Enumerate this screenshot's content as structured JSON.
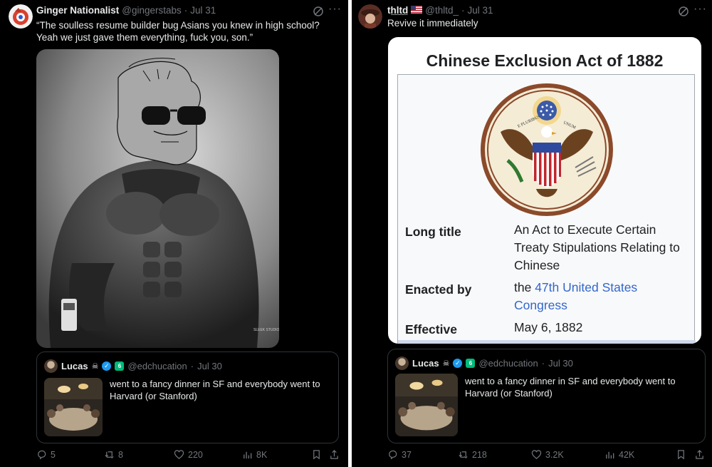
{
  "left_tweet": {
    "display_name": "Ginger Nationalist",
    "handle": "@gingerstabs",
    "date": "Jul 31",
    "text": "“The soulless resume builder bug Asians you knew in high school? Yeah we just gave them everything, fuck you, son.”",
    "image_watermark": "SLEEK STUDIO",
    "quote": {
      "display_name": "Lucas",
      "handle": "@edchucation",
      "date": "Jul 30",
      "text": "went to a fancy dinner in SF and everybody went to Harvard (or Stanford)"
    },
    "stats": {
      "replies": "5",
      "reposts": "8",
      "likes": "220",
      "views": "8K"
    }
  },
  "right_tweet": {
    "display_name": "th̲l̲t̲d̲",
    "handle": "@thltd_",
    "date": "Jul 31",
    "text": "Revive it immediately",
    "document": {
      "title": "Chinese Exclusion Act of 1882",
      "rows": [
        {
          "label": "Long title",
          "value": "An Act to Execute Certain Treaty Stipulations Relating to Chinese"
        },
        {
          "label": "Enacted by",
          "value_prefix": "the ",
          "value_link": "47th United States Congress"
        },
        {
          "label": "Effective",
          "value": "May 6, 1882"
        }
      ],
      "seal_ribbon_left": "E PLURIBUS",
      "seal_ribbon_right": "UNUM"
    },
    "quote": {
      "display_name": "Lucas",
      "handle": "@edchucation",
      "date": "Jul 30",
      "text": "went to a fancy dinner in SF and everybody went to Harvard (or Stanford)"
    },
    "stats": {
      "replies": "37",
      "reposts": "218",
      "likes": "3.2K",
      "views": "42K"
    }
  },
  "separator": "·",
  "icons": {
    "more": "more-icon",
    "grok": "grok-icon",
    "reply": "reply-icon",
    "repost": "repost-icon",
    "like": "like-icon",
    "views": "views-icon",
    "bookmark": "bookmark-icon",
    "share": "share-icon"
  },
  "colors": {
    "background": "#000000",
    "text": "#e7e9ea",
    "muted": "#71767b",
    "verified": "#1d9bf0",
    "link": "#3366cc",
    "border": "#2f3336"
  }
}
